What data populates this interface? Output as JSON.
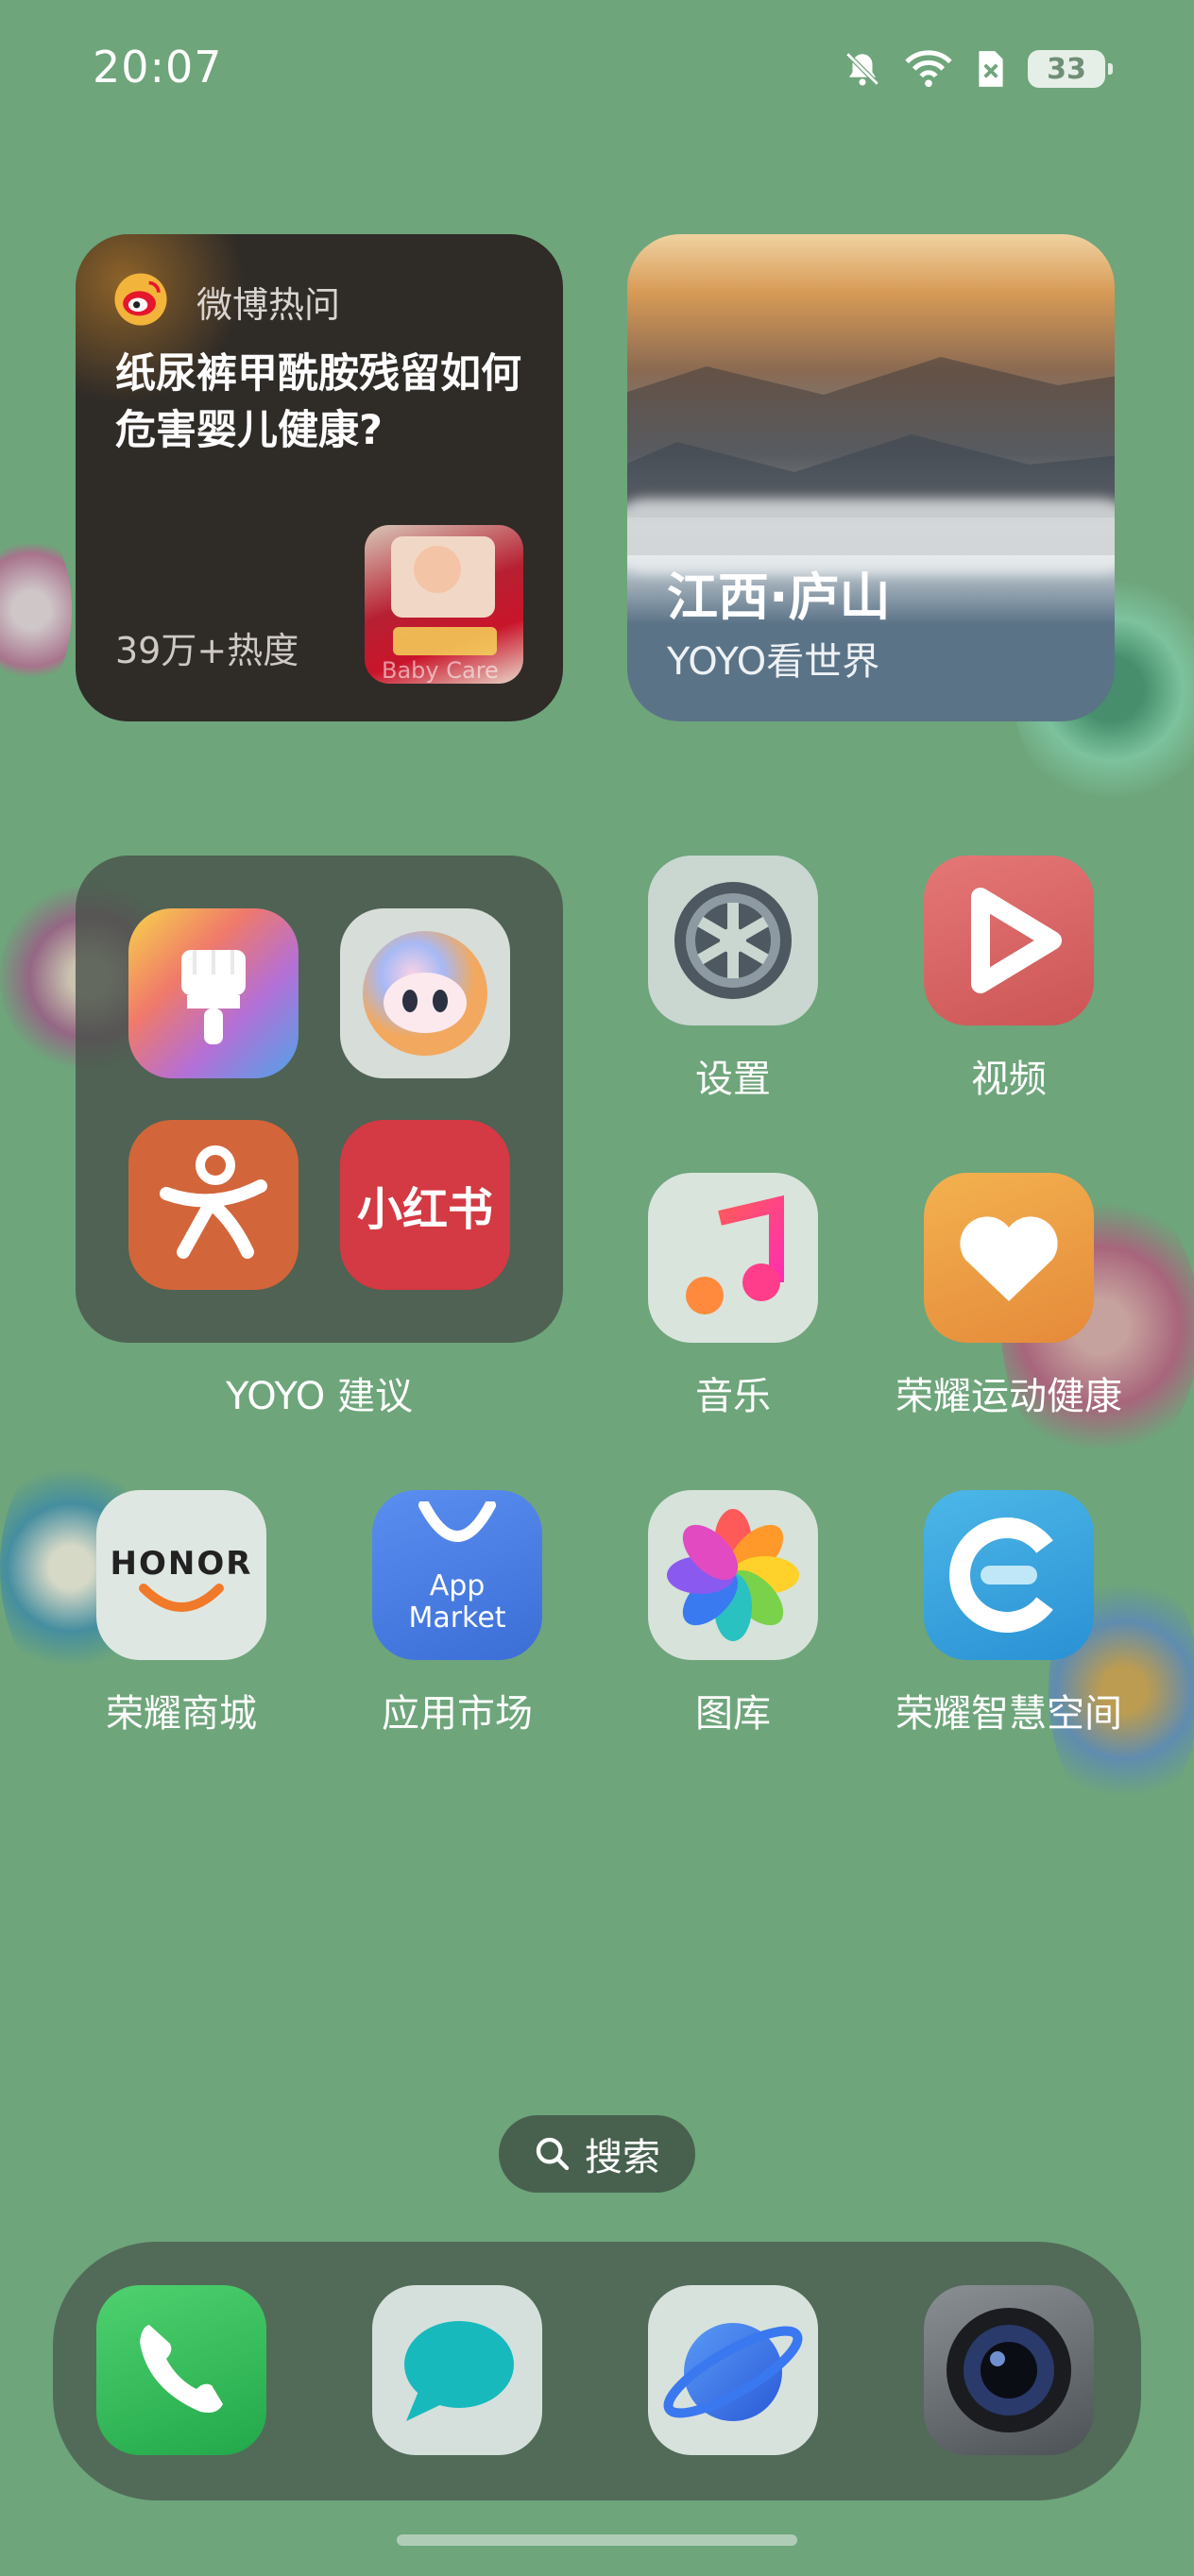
{
  "status_bar": {
    "time": "20:07",
    "battery": "33",
    "icons": [
      "bell-muted-icon",
      "wifi-icon",
      "sim-absent-icon",
      "battery-icon"
    ]
  },
  "widgets": {
    "weibo": {
      "source": "微博热问",
      "title": "纸尿裤甲酰胺残留如何危害婴儿健康?",
      "heat": "39万+热度",
      "thumbnail_text": "Baby Care"
    },
    "travel": {
      "place": "江西·庐山",
      "subtitle": "YOYO看世界"
    }
  },
  "folder": {
    "label": "YOYO 建议",
    "apps": [
      {
        "name": "theme",
        "icon": "paintbrush-icon"
      },
      {
        "name": "yoyo",
        "icon": "yoyo-face-icon"
      },
      {
        "name": "dianping",
        "icon": "dianping-icon"
      },
      {
        "name": "xiaohongshu",
        "icon": "xiaohongshu-icon",
        "icon_text": "小红书"
      }
    ]
  },
  "apps": {
    "settings": "设置",
    "video": "视频",
    "music": "音乐",
    "health": "荣耀运动健康",
    "honor_store": "荣耀商城",
    "honor_logo": "HONOR",
    "app_market": "应用市场",
    "app_market_icon_text_1": "App",
    "app_market_icon_text_2": "Market",
    "gallery": "图库",
    "smart_space": "荣耀智慧空间"
  },
  "search": {
    "label": "搜索"
  },
  "dock": [
    "phone-icon",
    "messages-icon",
    "browser-icon",
    "camera-icon"
  ],
  "colors": {
    "wallpaper": "#6ea57b",
    "dock": "#4e5c52",
    "weibo_widget": "#2f2b27"
  }
}
